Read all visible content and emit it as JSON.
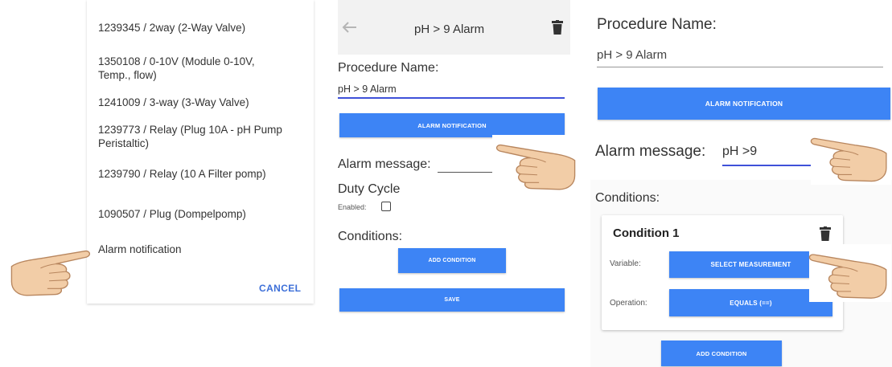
{
  "panel1": {
    "items": [
      "1239345 / 2way (2-Way Valve)",
      "1350108 / 0-10V (Module 0-10V, Temp., flow)",
      "1241009 / 3-way (3-Way Valve)",
      "1239773 / Relay (Plug 10A - pH Pump Peristaltic)",
      "1239790 / Relay (10 A Filter pomp)",
      "1090507 / Plug (Dompelpomp)",
      "Alarm notification"
    ],
    "cancel_label": "CANCEL"
  },
  "panel2": {
    "back_icon": "arrow-left-icon",
    "title": "pH > 9 Alarm",
    "delete_icon": "trash-icon",
    "procedure_name_label": "Procedure Name:",
    "procedure_name_value": "pH > 9 Alarm",
    "alarm_notification_label": "ALARM NOTIFICATION",
    "alarm_message_label": "Alarm message:",
    "alarm_message_value": "",
    "duty_cycle_label": "Duty Cycle",
    "enabled_label": "Enabled:",
    "enabled_checked": false,
    "conditions_label": "Conditions:",
    "add_condition_label": "ADD CONDITION",
    "save_label": "SAVE"
  },
  "panel3": {
    "procedure_name_label": "Procedure Name:",
    "procedure_name_value": "pH > 9 Alarm",
    "alarm_notification_label": "ALARM NOTIFICATION",
    "alarm_message_label": "Alarm message:",
    "alarm_message_value": "pH >9",
    "conditions_label": "Conditions:",
    "condition": {
      "title": "Condition 1",
      "delete_icon": "trash-icon",
      "variable_label": "Variable:",
      "variable_button": "SELECT MEASUREMENT",
      "operation_label": "Operation:",
      "operation_button": "EQUALS (==)"
    },
    "add_condition_label": "ADD CONDITION"
  },
  "colors": {
    "accent": "#3d84f5",
    "input_underline": "#3f51d9",
    "cancel": "#3d6fd8"
  }
}
